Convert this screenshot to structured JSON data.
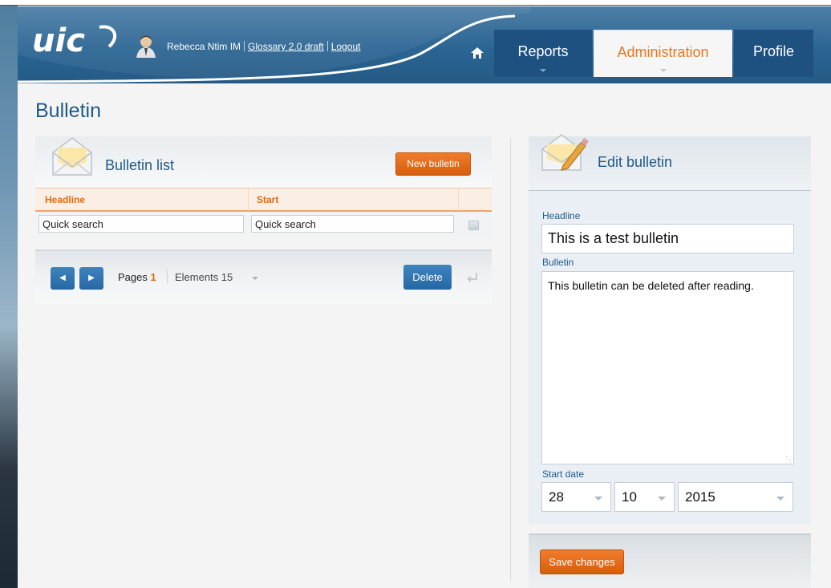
{
  "header": {
    "user_name": "Rebecca Ntim IM",
    "glossary_link": "Glossary 2.0 draft",
    "logout_link": "Logout",
    "logo_text": "uic"
  },
  "nav": {
    "tabs": [
      {
        "label": "Reports"
      },
      {
        "label": "Administration",
        "active": true
      },
      {
        "label": "Profile"
      }
    ]
  },
  "page": {
    "title": "Bulletin"
  },
  "bulletin_list": {
    "title": "Bulletin list",
    "new_button": "New bulletin",
    "columns": [
      "Headline",
      "Start"
    ],
    "search_placeholders": [
      "Quick search",
      "Quick search"
    ],
    "pager": {
      "pages_label": "Pages",
      "current_page": "1",
      "elements_label": "Elements 15"
    },
    "delete_button": "Delete"
  },
  "edit_bulletin": {
    "title": "Edit bulletin",
    "headline_label": "Headline",
    "headline_value": "This is a test bulletin",
    "bulletin_label": "Bulletin",
    "bulletin_value": "This bulletin can be deleted after reading.",
    "start_date_label": "Start date",
    "start_day": "28",
    "start_month": "10",
    "start_year": "2015",
    "save_button": "Save changes"
  },
  "colors": {
    "brand_blue": "#1f5a8a",
    "accent_orange": "#e06b14",
    "header_blue": "#2b6593"
  }
}
